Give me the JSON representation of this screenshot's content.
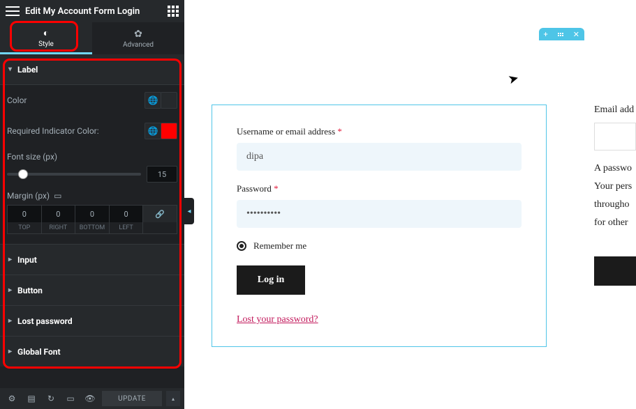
{
  "editor": {
    "title": "Edit My Account Form Login",
    "tabs": {
      "style": "Style",
      "advanced": "Advanced"
    },
    "sections": {
      "label": "Label",
      "input": "Input",
      "button": "Button",
      "lost_password": "Lost password",
      "global_font": "Global Font"
    },
    "label_controls": {
      "color_label": "Color",
      "req_indicator_label": "Required Indicator Color:",
      "font_size_label": "Font size (px)",
      "font_size_value": "15",
      "margin_label": "Margin (px)",
      "dims": {
        "top": {
          "value": "0",
          "label": "TOP"
        },
        "right": {
          "value": "0",
          "label": "RIGHT"
        },
        "bottom": {
          "value": "0",
          "label": "BOTTOM"
        },
        "left": {
          "value": "0",
          "label": "LEFT"
        }
      }
    },
    "footer": {
      "update": "UPDATE"
    }
  },
  "form": {
    "username_label": "Username or email address",
    "username_value": "dipa",
    "password_label": "Password",
    "password_value": "••••••••••",
    "remember_label": "Remember me",
    "login_label": "Log in",
    "lost_pw": "Lost your password?"
  },
  "peek": {
    "email_label": "Email add",
    "hint1": "A passwo",
    "hint2": "Your pers",
    "hint3": "througho",
    "hint4": "for other"
  }
}
